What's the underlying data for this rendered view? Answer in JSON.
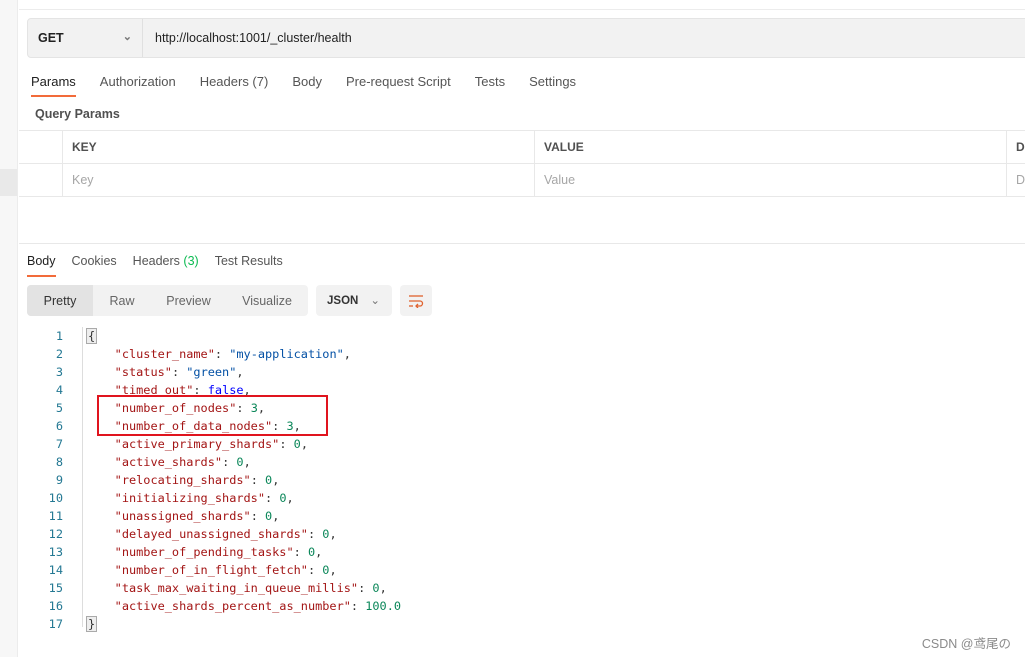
{
  "request": {
    "method": "GET",
    "url": "http://localhost:1001/_cluster/health"
  },
  "request_tabs": [
    {
      "label": "Params",
      "active": true
    },
    {
      "label": "Authorization"
    },
    {
      "label": "Headers (7)"
    },
    {
      "label": "Body"
    },
    {
      "label": "Pre-request Script"
    },
    {
      "label": "Tests"
    },
    {
      "label": "Settings"
    }
  ],
  "query_params": {
    "title": "Query Params",
    "columns": [
      "KEY",
      "VALUE",
      "D"
    ],
    "placeholders": [
      "Key",
      "Value",
      "D"
    ]
  },
  "response_tabs": {
    "body": "Body",
    "cookies": "Cookies",
    "headers": "Headers",
    "headers_count": "(3)",
    "test_results": "Test Results"
  },
  "view_modes": [
    "Pretty",
    "Raw",
    "Preview",
    "Visualize"
  ],
  "format": "JSON",
  "json_lines": [
    {
      "key": "cluster_name",
      "value": "\"my-application\"",
      "type": "s"
    },
    {
      "key": "status",
      "value": "\"green\"",
      "type": "s"
    },
    {
      "key": "timed_out",
      "value": "false",
      "type": "b"
    },
    {
      "key": "number_of_nodes",
      "value": "3",
      "type": "n"
    },
    {
      "key": "number_of_data_nodes",
      "value": "3",
      "type": "n"
    },
    {
      "key": "active_primary_shards",
      "value": "0",
      "type": "n"
    },
    {
      "key": "active_shards",
      "value": "0",
      "type": "n"
    },
    {
      "key": "relocating_shards",
      "value": "0",
      "type": "n"
    },
    {
      "key": "initializing_shards",
      "value": "0",
      "type": "n"
    },
    {
      "key": "unassigned_shards",
      "value": "0",
      "type": "n"
    },
    {
      "key": "delayed_unassigned_shards",
      "value": "0",
      "type": "n"
    },
    {
      "key": "number_of_pending_tasks",
      "value": "0",
      "type": "n"
    },
    {
      "key": "number_of_in_flight_fetch",
      "value": "0",
      "type": "n"
    },
    {
      "key": "task_max_waiting_in_queue_millis",
      "value": "0",
      "type": "n"
    },
    {
      "key": "active_shards_percent_as_number",
      "value": "100.0",
      "type": "n"
    }
  ],
  "open_brace": "{",
  "close_brace": "}",
  "watermark": "CSDN @鸢尾の",
  "colors": {
    "accent": "#f26b3a",
    "highlight_box": "#e0141e"
  }
}
